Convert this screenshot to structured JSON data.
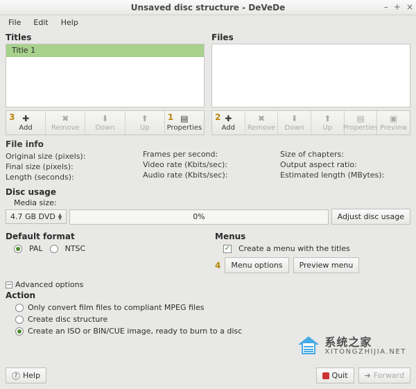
{
  "window": {
    "title": "Unsaved disc structure - DeVeDe",
    "min": "–",
    "max": "+",
    "close": "×"
  },
  "menubar": {
    "file": "File",
    "edit": "Edit",
    "help": "Help"
  },
  "titles": {
    "label": "Titles",
    "items": [
      "Title 1"
    ],
    "toolbar": {
      "add": "Add",
      "badge_add": "3",
      "remove": "Remove",
      "down": "Down",
      "up": "Up",
      "properties": "Properties",
      "badge_props": "1"
    }
  },
  "files": {
    "label": "Files",
    "toolbar": {
      "add": "Add",
      "badge_add": "2",
      "remove": "Remove",
      "down": "Down",
      "up": "Up",
      "properties": "Properties",
      "preview": "Preview"
    }
  },
  "fileinfo": {
    "heading": "File info",
    "col1": {
      "a": "Original size (pixels):",
      "b": "Final size (pixels):",
      "c": "Length (seconds):"
    },
    "col2": {
      "a": "Frames per second:",
      "b": "Video rate (Kbits/sec):",
      "c": "Audio rate (Kbits/sec):"
    },
    "col3": {
      "a": "Size of chapters:",
      "b": "Output aspect ratio:",
      "c": "Estimated length (MBytes):"
    }
  },
  "discusage": {
    "heading": "Disc usage",
    "media_label": "Media size:",
    "media_value": "4.7 GB DVD",
    "progress": "0%",
    "adjust": "Adjust disc usage"
  },
  "format": {
    "heading": "Default format",
    "pal": "PAL",
    "ntsc": "NTSC"
  },
  "menus": {
    "heading": "Menus",
    "create_label": "Create a menu with the titles",
    "badge": "4",
    "options": "Menu options",
    "preview": "Preview menu"
  },
  "advanced": "Advanced options",
  "action": {
    "heading": "Action",
    "opt1": "Only convert film files to compliant MPEG files",
    "opt2": "Create disc structure",
    "opt3": "Create an ISO or BIN/CUE image, ready to burn to a disc"
  },
  "bottombar": {
    "help": "Help",
    "quit": "Quit",
    "forward": "Forward"
  },
  "watermark": {
    "cn": "系统之家",
    "url": "XITONGZHIJIA.NET"
  }
}
